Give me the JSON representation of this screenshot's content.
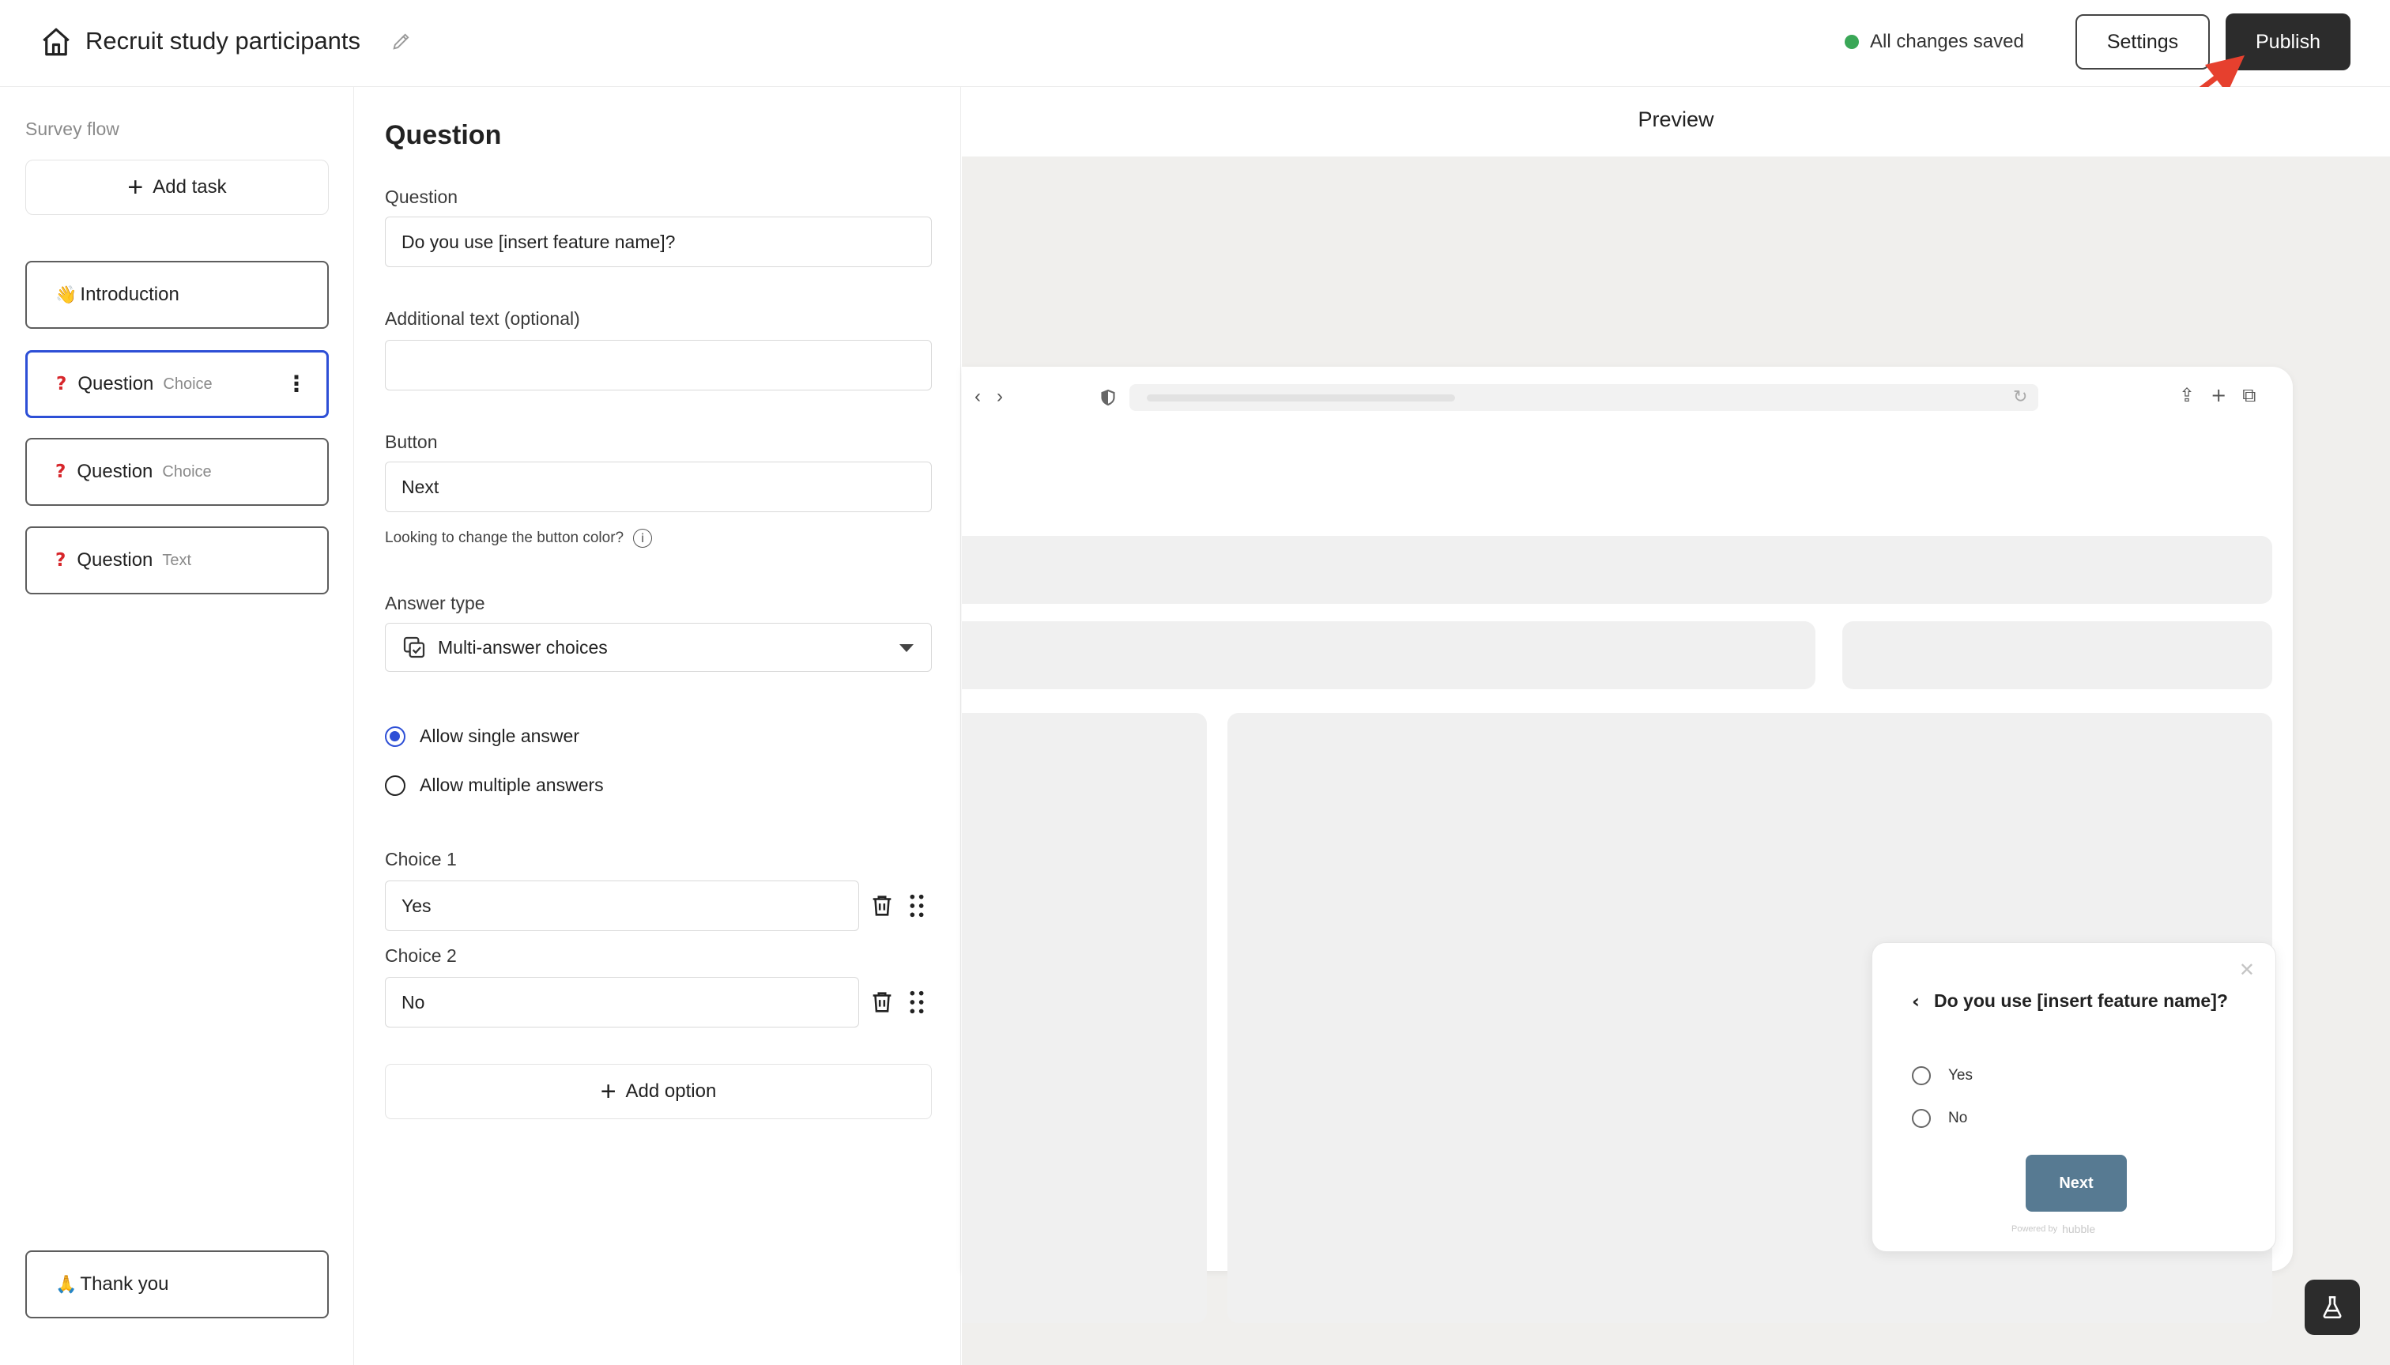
{
  "header": {
    "title": "Recruit study participants",
    "save_status": "All changes saved",
    "settings_label": "Settings",
    "publish_label": "Publish",
    "colors": {
      "saved_dot": "#3aa757",
      "publish_bg": "#2c2c2c",
      "annotation_arrow": "#e6402e"
    },
    "icons": [
      "home-icon",
      "pencil-icon"
    ]
  },
  "sidebar": {
    "heading": "Survey flow",
    "add_task_label": "Add task",
    "items": [
      {
        "emoji": "👋",
        "label": "Introduction",
        "sub": ""
      },
      {
        "emoji": "❓",
        "label": "Question",
        "sub": "Choice",
        "active": true
      },
      {
        "emoji": "❓",
        "label": "Question",
        "sub": "Choice"
      },
      {
        "emoji": "❓",
        "label": "Question",
        "sub": "Text"
      }
    ],
    "thank_you": {
      "emoji": "🙏",
      "label": "Thank you"
    },
    "colors": {
      "active_border": "#2d4fd6"
    }
  },
  "editor": {
    "title": "Question",
    "question_label": "Question",
    "question_value": "Do you use [insert feature name]?",
    "additional_label": "Additional text (optional)",
    "additional_value": "",
    "button_label": "Button",
    "button_value": "Next",
    "button_hint": "Looking to change the button color?",
    "answer_type_label": "Answer type",
    "answer_type_value": "Multi-answer choices",
    "radio_single": "Allow single answer",
    "radio_multiple": "Allow multiple answers",
    "selected_mode": "single",
    "choices": [
      {
        "label": "Choice 1",
        "value": "Yes"
      },
      {
        "label": "Choice 2",
        "value": "No"
      }
    ],
    "add_option_label": "Add option"
  },
  "preview": {
    "title": "Preview",
    "widget": {
      "question": "Do you use [insert feature name]?",
      "options": [
        "Yes",
        "No"
      ],
      "next_label": "Next",
      "powered_by": "Powered by",
      "brand": "hubble",
      "colors": {
        "next_bg": "#577a92"
      }
    }
  }
}
